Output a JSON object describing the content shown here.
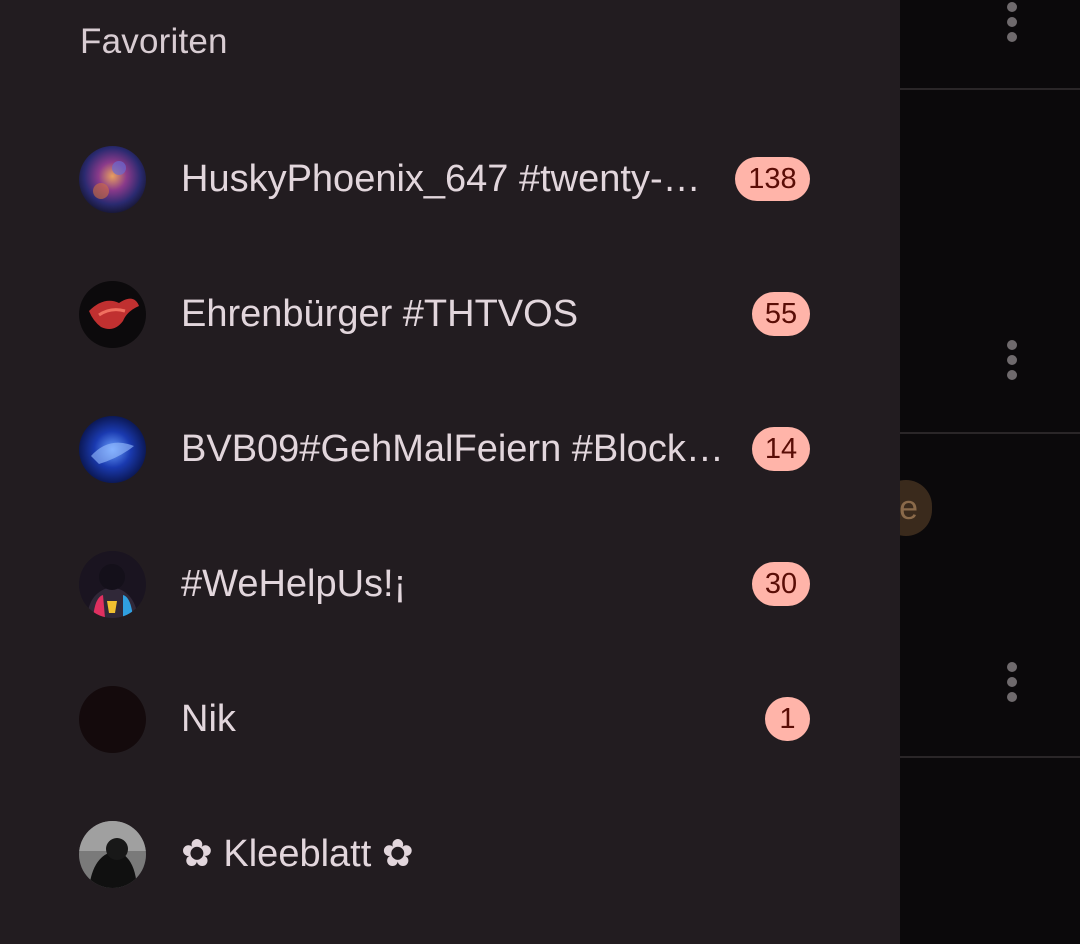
{
  "drawer": {
    "title": "Favoriten",
    "items": [
      {
        "name": "HuskyPhoenix_647 #twenty-…",
        "badge": "138",
        "avatar_icon": "nebula-avatar-icon"
      },
      {
        "name": "Ehrenbürger #THTVOS",
        "badge": "55",
        "avatar_icon": "red-bird-avatar-icon"
      },
      {
        "name": "BVB09#GehMalFeiern #Block…",
        "badge": "14",
        "avatar_icon": "blue-wolf-avatar-icon"
      },
      {
        "name": "#WeHelpUs!¡",
        "badge": "30",
        "avatar_icon": "hooded-figure-avatar-icon"
      },
      {
        "name": "Nik",
        "badge": "1",
        "avatar_icon": "dark-avatar-icon"
      },
      {
        "name": "✿ Kleeblatt ✿",
        "badge": "",
        "avatar_icon": "bw-portrait-avatar-icon"
      }
    ]
  },
  "background": {
    "chip_letter": "e"
  },
  "colors": {
    "drawer_bg": "#221c20",
    "badge_bg": "#ffb4a9",
    "badge_text": "#5a0d06",
    "text": "#e2d6dc"
  }
}
